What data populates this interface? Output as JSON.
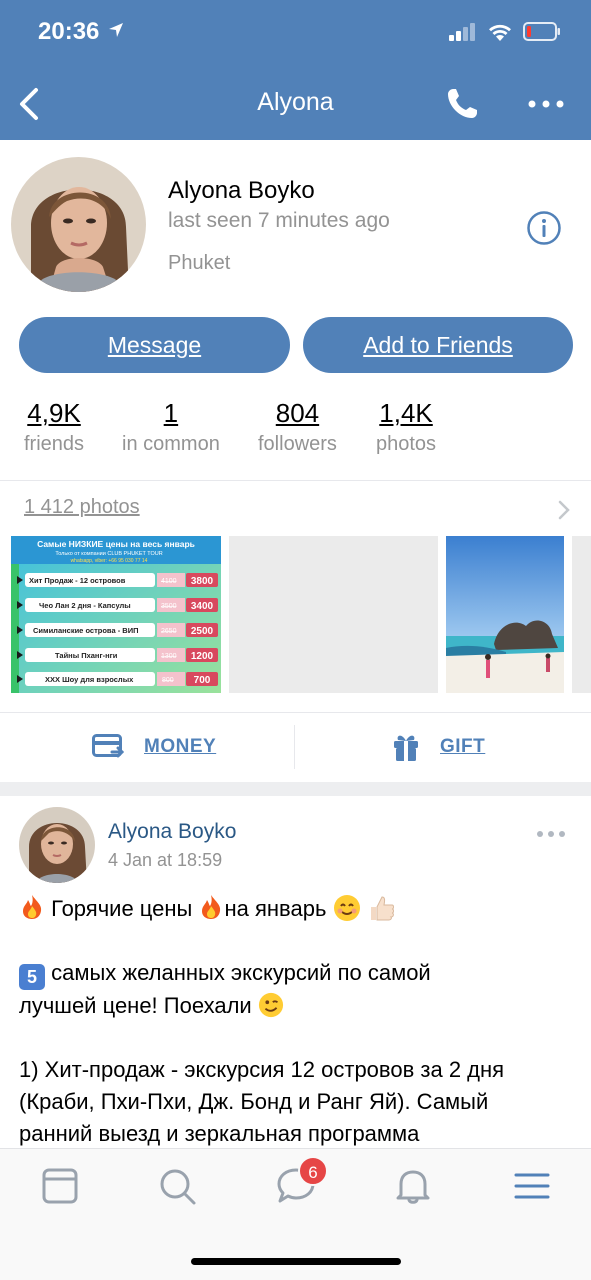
{
  "status_bar": {
    "time": "20:36"
  },
  "nav": {
    "title": "Alyona"
  },
  "profile": {
    "name": "Alyona Boyko",
    "last_seen": "last seen 7 minutes ago",
    "city": "Phuket",
    "message_label": "Message",
    "add_friend_label": "Add to Friends"
  },
  "counters": [
    {
      "value": "4,9K",
      "label": "friends"
    },
    {
      "value": "1",
      "label": "in common"
    },
    {
      "value": "804",
      "label": "followers"
    },
    {
      "value": "1,4K",
      "label": "photos"
    }
  ],
  "photos": {
    "link_label": "1 412 photos",
    "promo": {
      "header": "Самые НИЗКИЕ цены на весь январь",
      "sub": "Только от компании CLUB PHUKET TOUR",
      "contact": "whatsapp, viber: +66 95 030 77 14",
      "rows": [
        {
          "name": "Хит Продаж - 12 островов",
          "old": "4100",
          "price": "3800"
        },
        {
          "name": "Чео Лан 2 дня - Капсулы",
          "old": "3500",
          "price": "3400"
        },
        {
          "name": "Симиланские острова - ВИП",
          "old": "2650",
          "price": "2500"
        },
        {
          "name": "Тайны Пханг-нги",
          "old": "1300",
          "price": "1200"
        },
        {
          "name": "ХХХ Шоу для взрослых",
          "old": "800",
          "price": "700"
        }
      ]
    }
  },
  "actions": {
    "money_label": "MONEY",
    "gift_label": "GIFT"
  },
  "post": {
    "author": "Alyona Boyko",
    "date": "4 Jan at 18:59",
    "line1_a": "Горячие цены",
    "line1_b": "на январь",
    "number_badge": "5",
    "line2": "самых желанных экскурсий по самой",
    "line3": "лучшей цене! Поехали",
    "line4": "1) Хит-продаж - экскурсия 12 островов за 2 дня",
    "line5": "(Краби, Пхи-Пхи, Дж. Бонд и Ранг Яй). Самый",
    "line6": "ранний выезд и зеркальная программа"
  },
  "tabbar": {
    "messages_badge": "6"
  },
  "colors": {
    "brand": "#5181b8",
    "link": "#2a5885",
    "badge": "#e64646",
    "muted": "#939393"
  }
}
